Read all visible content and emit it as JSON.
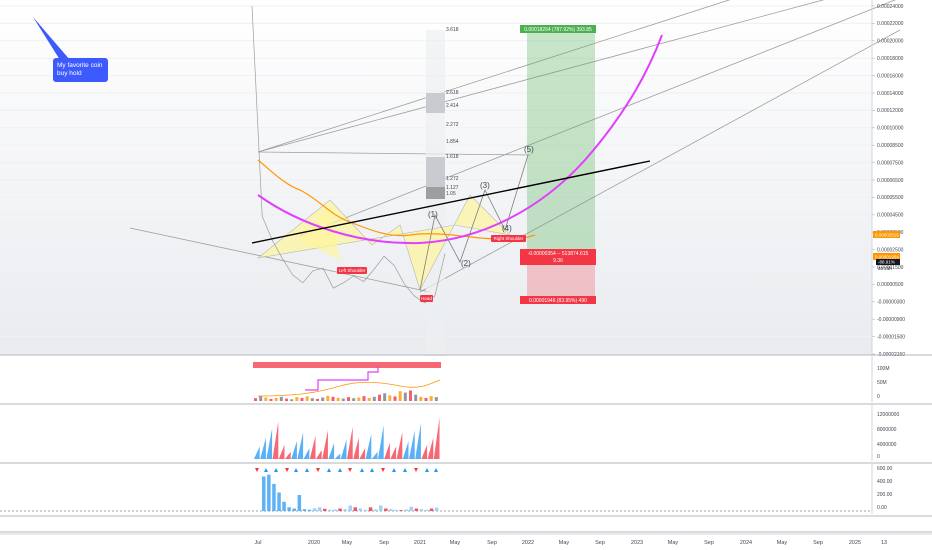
{
  "note": {
    "line1": "My favorite coin",
    "line2": "buy hold"
  },
  "price_axis": {
    "labels": [
      "0.00024000",
      "0.00022000",
      "0.00020000",
      "0.00018000",
      "0.00016000",
      "0.00014000",
      "0.00012000",
      "0.00010000",
      "0.00008500",
      "0.00007500",
      "0.00006500",
      "0.00005500",
      "0.00004500",
      "0.00003500",
      "0.00002500",
      "0.00001500",
      "0.00000500",
      "-0.00000300",
      "-0.00000900",
      "-0.00001500",
      "-0.00002150"
    ],
    "current_green": "0.00002516",
    "current_orange": "0.00001954",
    "marker_black": "-88.91%",
    "marker_black_sub": "33 21h"
  },
  "fib_levels": [
    "3.618",
    "2.618",
    "2.414",
    "2.272",
    "1.854",
    "1.618",
    "1.272",
    "1.127",
    "1.05"
  ],
  "waves": [
    "(1)",
    "(2)",
    "(3)",
    "(4)",
    "(5)"
  ],
  "pattern_tags": {
    "left_shoulder": "Left Shoulder",
    "head": "Head",
    "right_shoulder": "Right Shoulder"
  },
  "position": {
    "target_label": "0.00018264 (787.92%) 393.85",
    "entry_label": "-0.00000354 -- 513874.615",
    "entry_sub": "9.36",
    "stop_label": "0.00001946 (83.95%) 490"
  },
  "volume_axis": [
    "100M",
    "50M",
    "0"
  ],
  "obv_axis": [
    "12000000",
    "8000000",
    "4000000",
    "0"
  ],
  "osc_axis": [
    "600.00",
    "400.00",
    "200.00",
    "0.00",
    "0.00"
  ],
  "time_axis": [
    "Jul",
    "2020",
    "May",
    "Sep",
    "2021",
    "May",
    "Sep",
    "2022",
    "May",
    "Sep",
    "2023",
    "May",
    "Sep",
    "2024",
    "May",
    "Sep",
    "2025",
    "13"
  ],
  "colors": {
    "accent_green": "#4caf50",
    "accent_red": "#f23645",
    "magenta": "#e040fb",
    "orange": "#ff9800",
    "yellow_fill": "#fff59d",
    "blue_note": "#3d5afe"
  },
  "chart_data": [
    {
      "type": "line",
      "title": "",
      "xlabel": "",
      "ylabel": "",
      "ylim": [
        -2.15e-05,
        0.00024
      ],
      "x": [
        "2019-07",
        "2019-08",
        "2019-09",
        "2019-10",
        "2019-11",
        "2019-12",
        "2020-01",
        "2020-02",
        "2020-03",
        "2020-04",
        "2020-05",
        "2020-06",
        "2020-07",
        "2020-08",
        "2020-09",
        "2020-10",
        "2020-11",
        "2020-12",
        "2021-01",
        "2021-02"
      ],
      "series": [
        {
          "values": [
            0.00024,
            8.2e-05,
            6.4e-05,
            5e-05,
            3.8e-05,
            3.2e-05,
            4.1e-05,
            4.3e-05,
            2.8e-05,
            3.2e-05,
            3.7e-05,
            3.3e-05,
            4.2e-05,
            5.2e-05,
            4.5e-05,
            3.1e-05,
            2.2e-05,
            1.7e-05,
            2.2e-05,
            5.4e-05
          ]
        }
      ]
    },
    {
      "type": "bar",
      "title": "",
      "ylim": [
        0,
        100
      ],
      "values": [
        8,
        14,
        10,
        6,
        9,
        12,
        7,
        5,
        11,
        9,
        13,
        8,
        6,
        10,
        15,
        12,
        9,
        7,
        11,
        8,
        10,
        14,
        9,
        12,
        18,
        22,
        16,
        13,
        28,
        24,
        30,
        18,
        12,
        9,
        14,
        11
      ]
    },
    {
      "type": "bar",
      "title": "",
      "ylim": [
        0,
        14000000
      ],
      "values": [
        3500000,
        6000000,
        8500000,
        10500000,
        4000000,
        2000000,
        5000000,
        7500000,
        3000000,
        6500000,
        2500000,
        8000000,
        4500000,
        1500000,
        5500000,
        9000000,
        6000000,
        3000000,
        7000000,
        2000000,
        9500000,
        4500000,
        3500000,
        7500000,
        5000000,
        8000000,
        10000000,
        4000000,
        6000000,
        11500000
      ]
    },
    {
      "type": "bar",
      "title": "",
      "ylim": [
        0,
        650
      ],
      "values": [
        560,
        590,
        440,
        300,
        150,
        60,
        40,
        260,
        30,
        20,
        45,
        60,
        35,
        20,
        25,
        40,
        30,
        90,
        60,
        40,
        20,
        60,
        25,
        90,
        40,
        30,
        20,
        15,
        25,
        70,
        40,
        30,
        20,
        40,
        55
      ]
    }
  ]
}
